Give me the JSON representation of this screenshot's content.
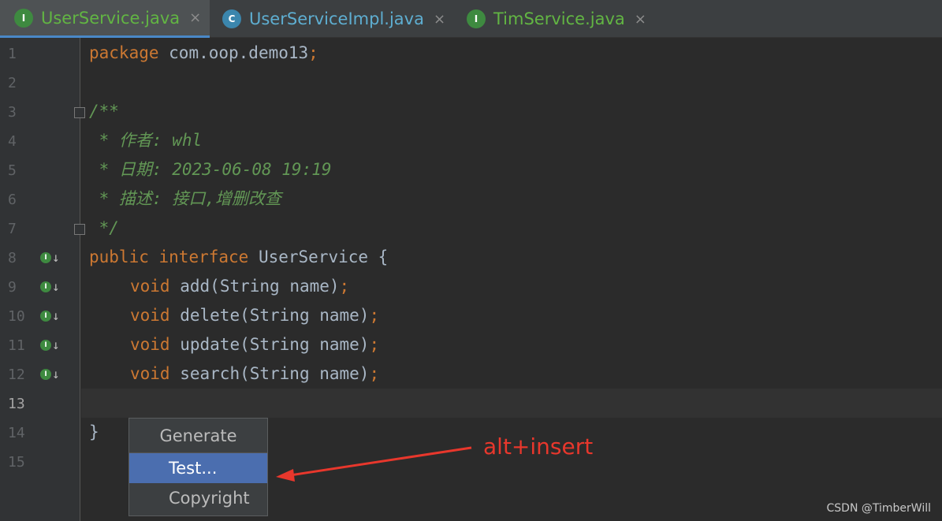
{
  "tabs": [
    {
      "label": "UserService.java",
      "badge": "I",
      "close": "×"
    },
    {
      "label": "UserServiceImpl.java",
      "badge": "C",
      "close": "×"
    },
    {
      "label": "TimService.java",
      "badge": "I",
      "close": "×"
    }
  ],
  "lines": [
    "1",
    "2",
    "3",
    "4",
    "5",
    "6",
    "7",
    "8",
    "9",
    "10",
    "11",
    "12",
    "13",
    "14",
    "15"
  ],
  "impl_badge": "I",
  "code": {
    "l1": {
      "kw": "package",
      "rest": " com.oop.demo13",
      "semi": ";"
    },
    "l3": "/**",
    "l4": " * 作者: whl",
    "l5": " * 日期: 2023-06-08 19:19",
    "l6": " * 描述: 接口,增删改查",
    "l7": " */",
    "l8": {
      "kw1": "public",
      "kw2": "interface",
      "rest": " UserService {"
    },
    "methods": [
      {
        "kw": "void",
        "name": "add",
        "args": "(String name)",
        "semi": ";"
      },
      {
        "kw": "void",
        "name": "delete",
        "args": "(String name)",
        "semi": ";"
      },
      {
        "kw": "void",
        "name": "update",
        "args": "(String name)",
        "semi": ";"
      },
      {
        "kw": "void",
        "name": "search",
        "args": "(String name)",
        "semi": ";"
      }
    ],
    "l14": "}"
  },
  "popup": {
    "title": "Generate",
    "items": [
      "Test...",
      "Copyright"
    ]
  },
  "annotation": "alt+insert",
  "watermark": "CSDN @TimberWill"
}
